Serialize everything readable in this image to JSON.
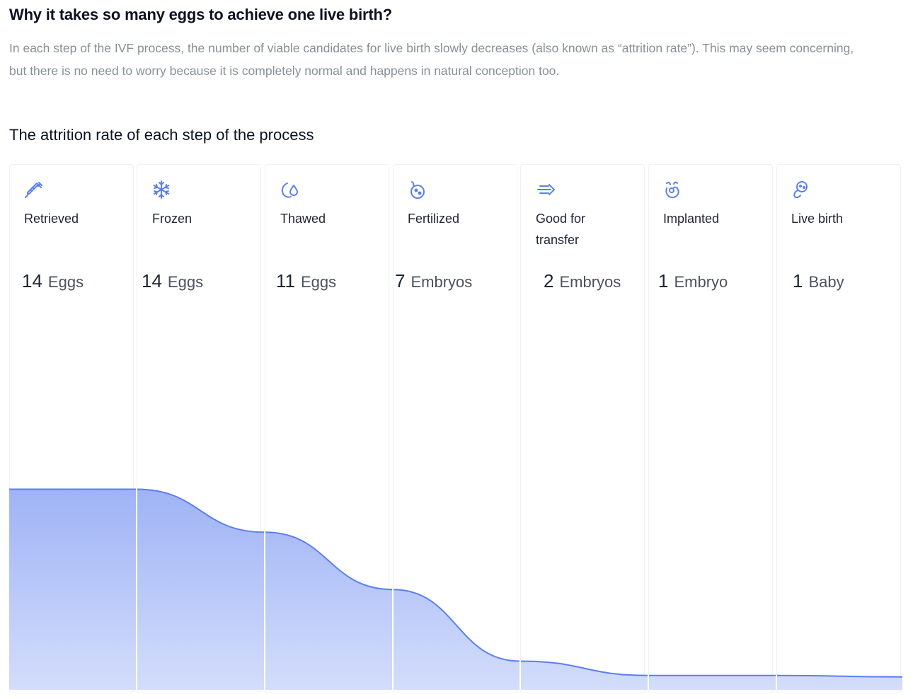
{
  "header": {
    "title": "Why it takes so many eggs to achieve one live birth?",
    "intro": "In each step of the IVF process, the number of viable candidates for live birth slowly decreases (also known as “attrition rate”). This may seem concerning, but there is no need to worry because it is completely normal and happens in natural conception too."
  },
  "colors": {
    "accent": "#5b7ff0",
    "fill_top": "#9fb3f5",
    "fill_bottom": "#d3ddfb",
    "card_border": "#eef0f3"
  },
  "chart_data": {
    "type": "area",
    "title": "The attrition rate of each step of the process",
    "xlabel": "",
    "ylabel": "",
    "ylim": [
      0,
      40
    ],
    "grid": false,
    "legend": "none",
    "categories": [
      "Retrieved",
      "Frozen",
      "Thawed",
      "Fertilized",
      "Good for transfer",
      "Implanted",
      "Live birth"
    ],
    "values": [
      14,
      14,
      11,
      7,
      2,
      1,
      1
    ],
    "units": [
      "Eggs",
      "Eggs",
      "Eggs",
      "Embryos",
      "Embryos",
      "Embryo",
      "Baby"
    ],
    "icons": [
      "syringe-icon",
      "snowflake-icon",
      "thaw-droplet-icon",
      "fertilized-egg-icon",
      "transfer-arrow-icon",
      "implant-icon",
      "baby-icon"
    ]
  }
}
